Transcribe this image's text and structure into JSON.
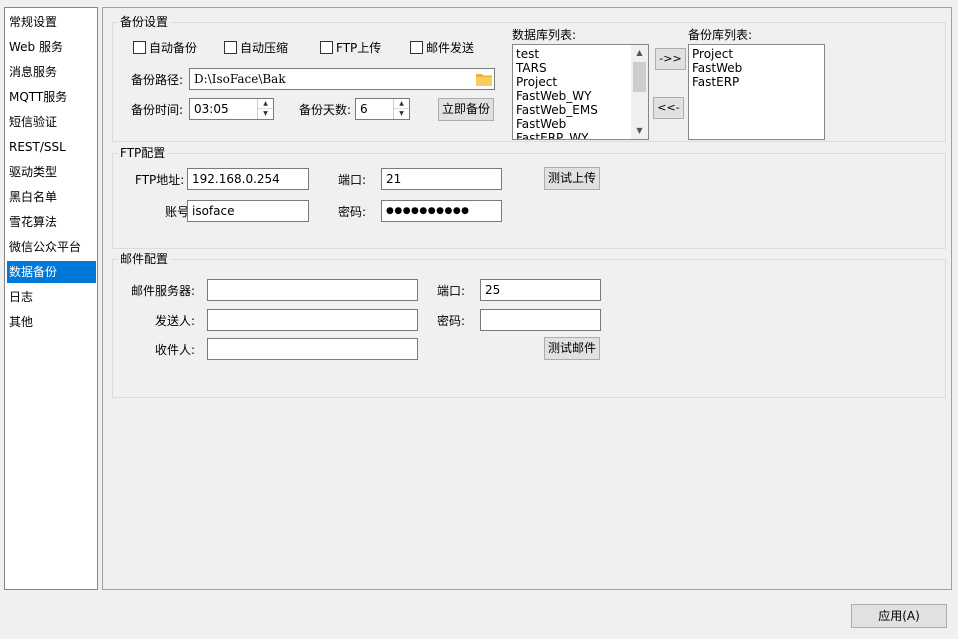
{
  "nav": {
    "items": [
      {
        "label": "常规设置",
        "selected": false
      },
      {
        "label": "Web 服务",
        "selected": false
      },
      {
        "label": "消息服务",
        "selected": false
      },
      {
        "label": "MQTT服务",
        "selected": false
      },
      {
        "label": "短信验证",
        "selected": false
      },
      {
        "label": "REST/SSL",
        "selected": false
      },
      {
        "label": "驱动类型",
        "selected": false
      },
      {
        "label": "黑白名单",
        "selected": false
      },
      {
        "label": "雪花算法",
        "selected": false
      },
      {
        "label": "微信公众平台",
        "selected": false
      },
      {
        "label": "数据备份",
        "selected": true
      },
      {
        "label": "日志",
        "selected": false
      },
      {
        "label": "其他",
        "selected": false
      }
    ],
    "selected_color": "#0078d7"
  },
  "backup": {
    "title": "备份设置",
    "checkboxes": {
      "auto_backup": {
        "label": "自动备份",
        "checked": false
      },
      "auto_compress": {
        "label": "自动压缩",
        "checked": false
      },
      "ftp_upload": {
        "label": "FTP上传",
        "checked": false
      },
      "mail_send": {
        "label": "邮件发送",
        "checked": false
      }
    },
    "path_label": "备份路径:",
    "path_value": "D:\\IsoFace\\Bak",
    "time_label": "备份时间:",
    "time_value": "03:05",
    "days_label": "备份天数:",
    "days_value": "6",
    "backup_now_label": "立即备份",
    "db_list_label": "数据库列表:",
    "db_list": [
      "test",
      "TARS",
      "Project",
      "FastWeb_WY",
      "FastWeb_EMS",
      "FastWeb",
      "FastERP_WY"
    ],
    "add_label": "->>",
    "remove_label": "<<-",
    "backup_list_label": "备份库列表:",
    "backup_list": [
      "Project",
      "FastWeb",
      "FastERP"
    ]
  },
  "ftp": {
    "title": "FTP配置",
    "address_label": "FTP地址:",
    "address_value": "192.168.0.254",
    "port_label": "端口:",
    "port_value": "21",
    "test_label": "测试上传",
    "account_label": "账号:",
    "account_value": "isoface",
    "password_label": "密码:",
    "password_value": "●●●●●●●●●●"
  },
  "mail": {
    "title": "邮件配置",
    "server_label": "邮件服务器:",
    "server_value": "",
    "port_label": "端口:",
    "port_value": "25",
    "sender_label": "发送人:",
    "sender_value": "",
    "password_label": "密码:",
    "password_value": "",
    "recipient_label": "收件人:",
    "recipient_value": "",
    "test_label": "测试邮件"
  },
  "footer": {
    "apply_label": "应用(A)"
  }
}
